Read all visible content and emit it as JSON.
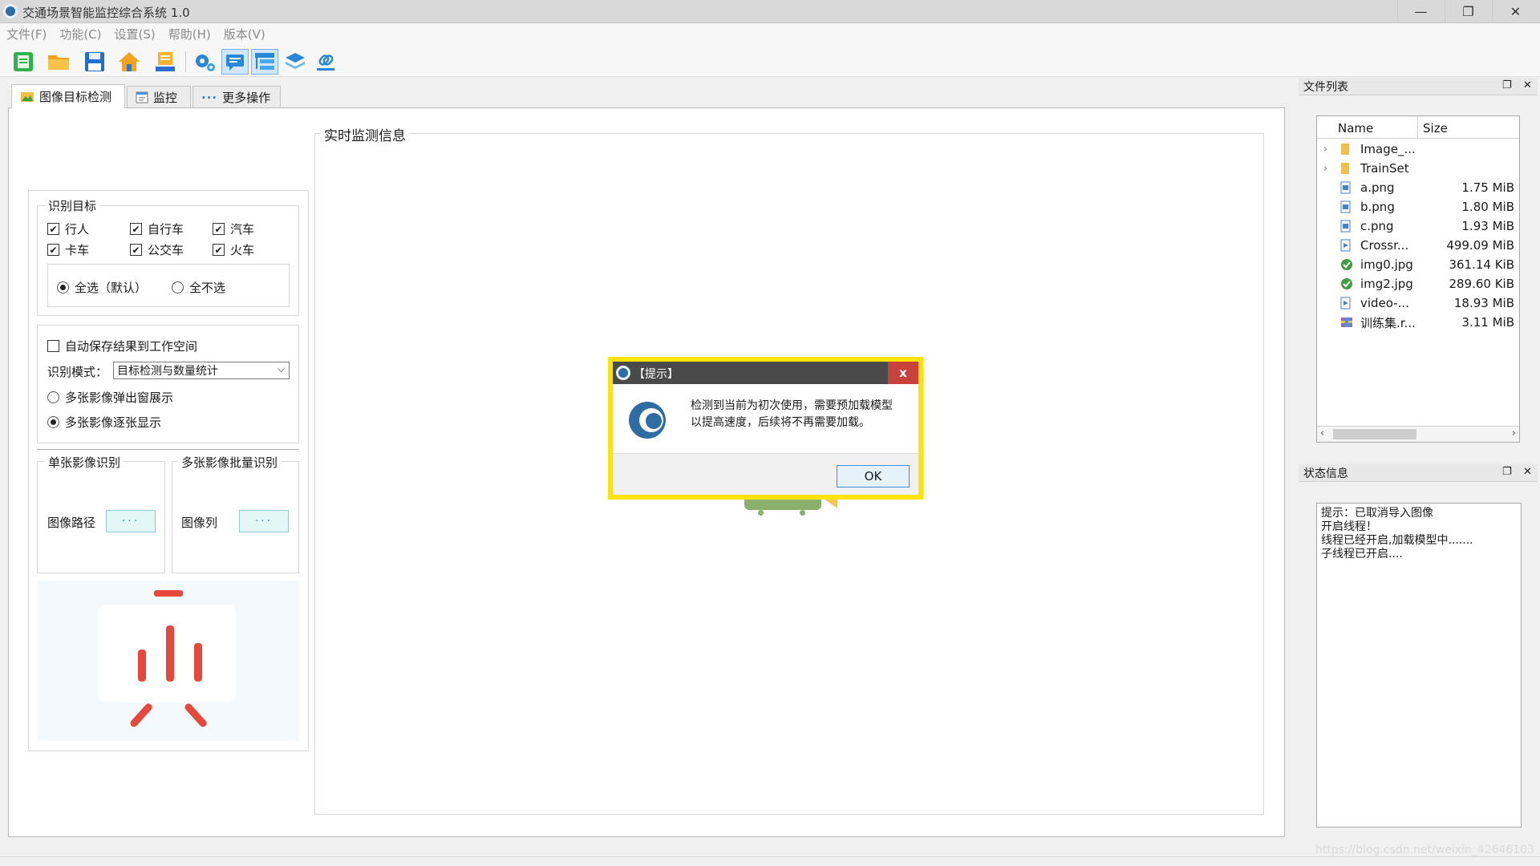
{
  "window": {
    "title": "交通场景智能监控综合系统 1.0",
    "controls": {
      "minimize": "—",
      "restore": "❐",
      "close": "✕"
    }
  },
  "menu": [
    "文件(F)",
    "功能(C)",
    "设置(S)",
    "帮助(H)",
    "版本(V)"
  ],
  "toolbar": {
    "icons": [
      "new-doc-icon",
      "open-folder-icon",
      "save-icon",
      "home-icon",
      "import-icon",
      "settings-icon",
      "message-icon",
      "tree-view-icon",
      "layers-icon",
      "link-icon"
    ],
    "active": [
      "message-icon",
      "tree-view-icon"
    ]
  },
  "tabs": [
    {
      "label": "图像目标检测",
      "icon": "image-icon",
      "selected": true
    },
    {
      "label": "监控",
      "icon": "monitor-icon",
      "selected": false
    },
    {
      "label": "更多操作",
      "icon": "dots-icon",
      "selected": false
    }
  ],
  "left": {
    "targets_title": "识别目标",
    "targets": [
      {
        "label": "行人",
        "checked": true
      },
      {
        "label": "自行车",
        "checked": true
      },
      {
        "label": "汽车",
        "checked": true
      },
      {
        "label": "卡车",
        "checked": true
      },
      {
        "label": "公交车",
        "checked": true
      },
      {
        "label": "火车",
        "checked": true
      }
    ],
    "select_all": "全选（默认）",
    "select_none": "全不选",
    "auto_save": "自动保存结果到工作空间",
    "mode_label": "识别模式：",
    "mode_value": "目标检测与数量统计",
    "multi_popup": "多张影像弹出窗展示",
    "multi_seq": "多张影像逐张显示",
    "single_title": "单张影像识别",
    "batch_title": "多张影像批量识别",
    "image_path": "图像路径",
    "image_list": "图像列",
    "browse": "···"
  },
  "center": {
    "title": "实时监测信息"
  },
  "files": {
    "title": "文件列表",
    "col_name": "Name",
    "col_size": "Size",
    "rows": [
      {
        "name": "Image_...",
        "size": "",
        "icon": "folder-icon",
        "expandable": true
      },
      {
        "name": "TrainSet",
        "size": "",
        "icon": "folder-icon",
        "expandable": true
      },
      {
        "name": "a.png",
        "size": "1.75 MiB",
        "icon": "image-file-icon",
        "expandable": false
      },
      {
        "name": "b.png",
        "size": "1.80 MiB",
        "icon": "image-file-icon",
        "expandable": false
      },
      {
        "name": "c.png",
        "size": "1.93 MiB",
        "icon": "image-file-icon",
        "expandable": false
      },
      {
        "name": "Crossr...",
        "size": "499.09 MiB",
        "icon": "video-file-icon",
        "expandable": false
      },
      {
        "name": "img0.jpg",
        "size": "361.14 KiB",
        "icon": "jpg-file-icon",
        "expandable": false
      },
      {
        "name": "img2.jpg",
        "size": "289.60 KiB",
        "icon": "jpg-file-icon",
        "expandable": false
      },
      {
        "name": "video-...",
        "size": "18.93 MiB",
        "icon": "video-file-icon",
        "expandable": false
      },
      {
        "name": "训练集.r...",
        "size": "3.11 MiB",
        "icon": "archive-file-icon",
        "expandable": false
      }
    ]
  },
  "status": {
    "title": "状态信息",
    "lines": [
      "提示：已取消导入图像",
      "开启线程！",
      "线程已经开启,加载模型中.......",
      "子线程已开启...."
    ]
  },
  "dialog": {
    "title": "【提示】",
    "message_line1": "检测到当前为初次使用，需要预加载模型",
    "message_line2": "以提高速度，后续将不再需要加载。",
    "ok": "OK",
    "close": "x"
  },
  "watermark": "https://blog.csdn.net/weixin_42646103",
  "colors": {
    "highlight": "#ffe400",
    "accent_red": "#e8473c",
    "dialog_title": "#4a4a4a"
  }
}
